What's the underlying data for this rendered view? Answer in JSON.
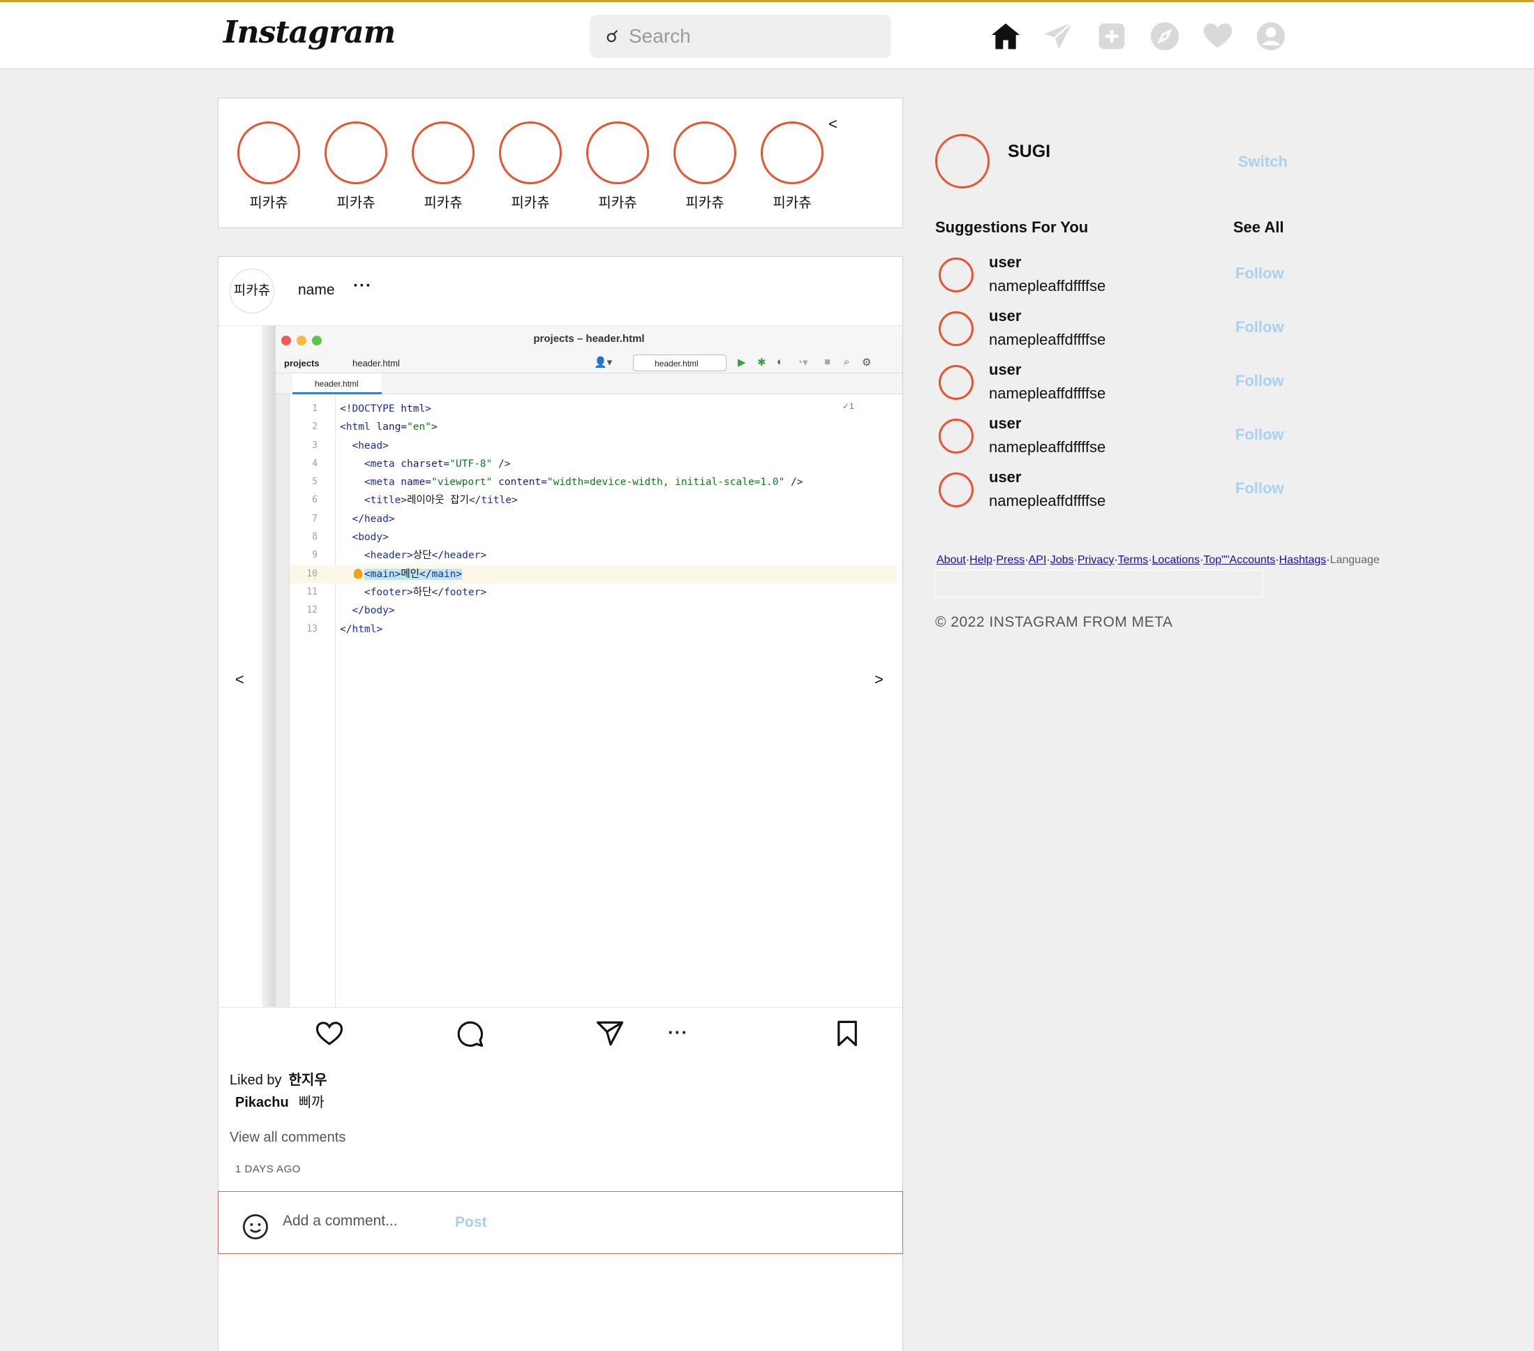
{
  "header": {
    "logo": "Instagram",
    "search_placeholder": "Search",
    "icons": [
      "home-icon",
      "paper-plane-icon",
      "add-post-icon",
      "explore-compass-icon",
      "heart-icon",
      "profile-icon"
    ]
  },
  "stories": {
    "items": [
      {
        "label": "피카츄"
      },
      {
        "label": "피카츄"
      },
      {
        "label": "피카츄"
      },
      {
        "label": "피카츄"
      },
      {
        "label": "피카츄"
      },
      {
        "label": "피카츄"
      },
      {
        "label": "피카츄"
      }
    ],
    "prev_arrow": "<"
  },
  "post": {
    "avatar_text": "피카츄",
    "name": "name",
    "more": "···",
    "prev": "<",
    "next": ">",
    "ide": {
      "window_title": "projects – header.html",
      "breadcrumb_project": "projects",
      "breadcrumb_file": "header.html",
      "file_selector": "header.html",
      "tab": "header.html",
      "inspection": "✓1",
      "lines": [
        {
          "n": "1",
          "code": "<!DOCTYPE html>"
        },
        {
          "n": "2",
          "code": "<html lang=\"en\">"
        },
        {
          "n": "3",
          "code": "  <head>"
        },
        {
          "n": "4",
          "code": "    <meta charset=\"UTF-8\" />"
        },
        {
          "n": "5",
          "code": "    <meta name=\"viewport\" content=\"width=device-width, initial-scale=1.0\" />"
        },
        {
          "n": "6",
          "code": "    <title>레이아웃 잡기</title>"
        },
        {
          "n": "7",
          "code": "  </head>"
        },
        {
          "n": "8",
          "code": "  <body>"
        },
        {
          "n": "9",
          "code": "    <header>상단</header>"
        },
        {
          "n": "10",
          "code": "    <main>메인</main>"
        },
        {
          "n": "11",
          "code": "    <footer>하단</footer>"
        },
        {
          "n": "12",
          "code": "  </body>"
        },
        {
          "n": "13",
          "code": "</html>"
        }
      ]
    },
    "liked_prefix": "Liked by",
    "liked_user": "한지우",
    "caption_user": "Pikachu",
    "caption_text": "삐까",
    "view_all": "View all comments",
    "time_ago": "1 DAYS AGO",
    "comment_placeholder": "Add a comment...",
    "post_button": "Post"
  },
  "sidebar": {
    "me_name": "SUGI",
    "switch": "Switch",
    "suggestions_title": "Suggestions For You",
    "see_all": "See All",
    "suggestions": [
      {
        "line1": "user",
        "line2": "namepleaffdffffse",
        "action": "Follow"
      },
      {
        "line1": "user",
        "line2": "namepleaffdffffse",
        "action": "Follow"
      },
      {
        "line1": "user",
        "line2": "namepleaffdffffse",
        "action": "Follow"
      },
      {
        "line1": "user",
        "line2": "namepleaffdffffse",
        "action": "Follow"
      },
      {
        "line1": "user",
        "line2": "namepleaffdffffse",
        "action": "Follow"
      }
    ],
    "footer_links": [
      "About",
      "Help",
      "Press",
      "API",
      "Jobs",
      "Privacy",
      "Terms",
      "Locations",
      "Top\"\"Accounts",
      "Hashtags"
    ],
    "language": "Language",
    "copyright": "© 2022 INSTAGRAM FROM META"
  },
  "colors": {
    "story_ring": "#e8542e",
    "follow_blue": "#a8d1f3",
    "background": "#efefef"
  }
}
